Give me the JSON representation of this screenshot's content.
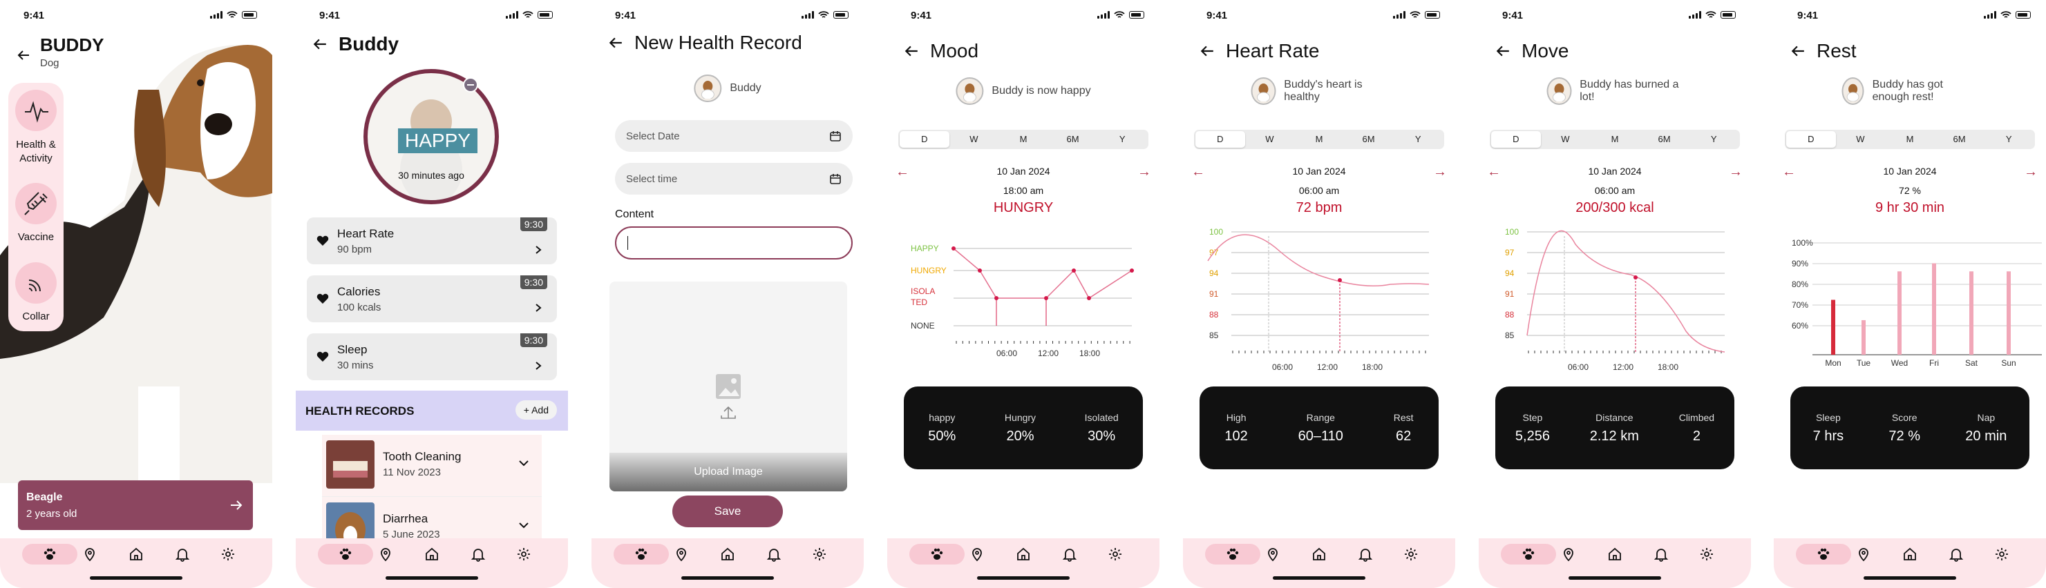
{
  "time": "9:41",
  "s1": {
    "name": "BUDDY",
    "breed": "Dog",
    "side": [
      {
        "label": "Health &\nActivity",
        "icon": "activity-icon"
      },
      {
        "label": "Vaccine",
        "icon": "syringe-icon"
      },
      {
        "label": "Collar",
        "icon": "collar-icon"
      }
    ],
    "card_title": "Beagle",
    "card_sub": "2 years old"
  },
  "s2": {
    "title": "Buddy",
    "mood": "HAPPY",
    "mood_time": "30 minutes ago",
    "items": [
      {
        "title": "Heart Rate",
        "sub": "90 bpm",
        "time": "9:30"
      },
      {
        "title": "Calories",
        "sub": "100 kcals",
        "time": "9:30"
      },
      {
        "title": "Sleep",
        "sub": "30 mins",
        "time": "9:30"
      }
    ],
    "records_title": "HEALTH RECORDS",
    "add_label": "+ Add",
    "records": [
      {
        "title": "Tooth Cleaning",
        "date": "11 Nov 2023"
      },
      {
        "title": "Diarrhea",
        "date": "5 June 2023"
      }
    ]
  },
  "s3": {
    "title": "New Health Record",
    "pet": "Buddy",
    "date_ph": "Select Date",
    "time_ph": "Select time",
    "content_label": "Content",
    "upload_label": "Upload Image",
    "save_label": "Save"
  },
  "periods": [
    "D",
    "W",
    "M",
    "6M",
    "Y"
  ],
  "mood": {
    "title": "Mood",
    "status": "Buddy is now happy",
    "date": "10 Jan 2024",
    "time": "18:00 am",
    "value": "HUNGRY",
    "stats": [
      {
        "k": "happy",
        "v": "50%"
      },
      {
        "k": "Hungry",
        "v": "20%"
      },
      {
        "k": "Isolated",
        "v": "30%"
      }
    ]
  },
  "heart": {
    "title": "Heart Rate",
    "status": "Buddy's heart is healthy",
    "date": "10 Jan 2024",
    "time": "06:00 am",
    "value": "72 bpm",
    "stats": [
      {
        "k": "High",
        "v": "102"
      },
      {
        "k": "Range",
        "v": "60–110"
      },
      {
        "k": "Rest",
        "v": "62"
      }
    ]
  },
  "move": {
    "title": "Move",
    "status": "Buddy has burned a lot!",
    "date": "10 Jan 2024",
    "time": "06:00 am",
    "value": "200/300 kcal",
    "stats": [
      {
        "k": "Step",
        "v": "5,256"
      },
      {
        "k": "Distance",
        "v": "2.12 km"
      },
      {
        "k": "Climbed",
        "v": "2"
      }
    ]
  },
  "rest": {
    "title": "Rest",
    "status": "Buddy has got enough rest!",
    "date": "10 Jan 2024",
    "time": "72 %",
    "value": "9 hr 30 min",
    "stats": [
      {
        "k": "Sleep",
        "v": "7 hrs"
      },
      {
        "k": "Score",
        "v": "72 %"
      },
      {
        "k": "Nap",
        "v": "20 min"
      }
    ]
  },
  "chart_data": [
    {
      "type": "line",
      "title": "Mood",
      "categories": [
        "HAPPY",
        "HUNGRY",
        "ISOLATED",
        "NONE"
      ],
      "x_ticks": [
        "06:00",
        "12:00",
        "18:00"
      ],
      "series": [
        {
          "values": [
            "HAPPY",
            "HUNGRY",
            "ISOLATED",
            "ISOLATED",
            "HUNGRY",
            "ISOLATED",
            "HUNGRY"
          ]
        }
      ],
      "colors": [
        "#7cc242",
        "#f0a800",
        "#d6303a",
        "#333333"
      ]
    },
    {
      "type": "line",
      "title": "Heart Rate",
      "y_ticks": [
        100,
        97,
        94,
        91,
        88,
        85
      ],
      "x_ticks": [
        "06:00",
        "12:00",
        "18:00"
      ],
      "ylim": [
        85,
        100
      ]
    },
    {
      "type": "line",
      "title": "Move",
      "y_ticks": [
        100,
        97,
        94,
        91,
        88,
        85
      ],
      "x_ticks": [
        "06:00",
        "12:00",
        "18:00"
      ],
      "ylim": [
        85,
        100
      ]
    },
    {
      "type": "bar",
      "title": "Rest",
      "categories": [
        "Mon",
        "Tue",
        "Wed",
        "Fri",
        "Sat",
        "Sun"
      ],
      "y_ticks": [
        "100%",
        "90%",
        "80%",
        "70%",
        "60%"
      ],
      "values": [
        72,
        62,
        86,
        90,
        86,
        86
      ],
      "ylim": [
        50,
        100
      ]
    }
  ]
}
